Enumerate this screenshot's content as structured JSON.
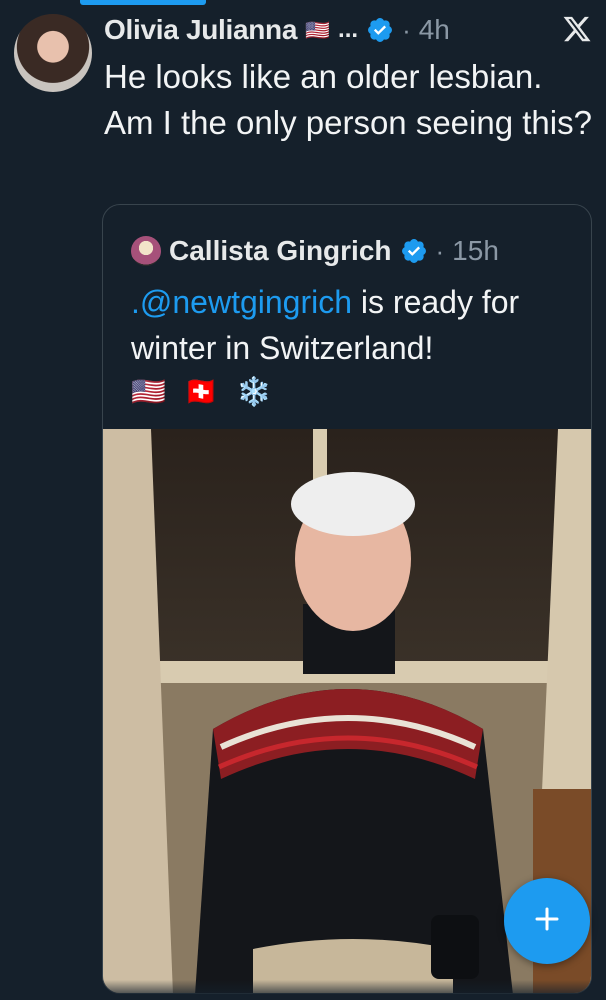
{
  "tweet": {
    "author_name": "Olivia Julianna",
    "name_flag": "🇺🇸",
    "name_truncation": "...",
    "separator": "·",
    "time": "4h",
    "text": "He looks like an older lesbian. Am I the only person seeing this?"
  },
  "quoted_tweet": {
    "author_name": "Callista Gingrich",
    "separator": "·",
    "time": "15h",
    "mention": ".@newtgingrich",
    "text_after_mention": " is ready for winter in Switzerland!",
    "emojis": [
      "🇺🇸",
      "🇨🇭",
      "❄️"
    ]
  },
  "icons": {
    "close": "x-logo-icon",
    "verified": "verified-badge-icon",
    "compose": "plus-icon"
  },
  "colors": {
    "background": "#15202b",
    "accent": "#1d9bf0",
    "secondary_text": "#8b98a5",
    "border": "#38444d"
  }
}
